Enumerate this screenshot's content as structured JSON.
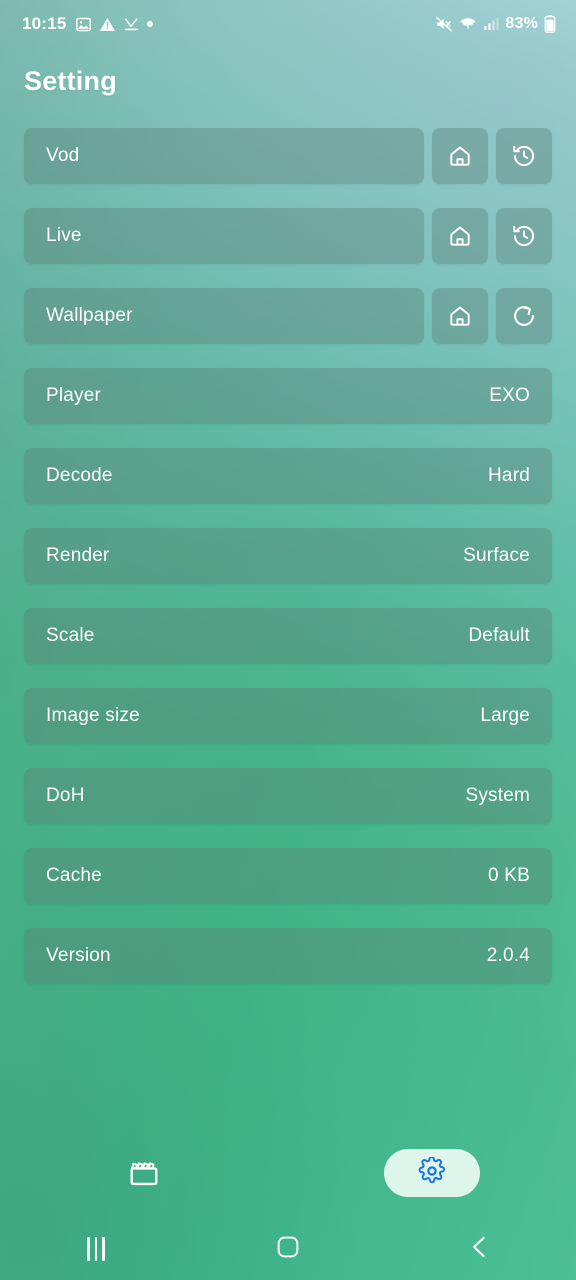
{
  "statusbar": {
    "time": "10:15",
    "left_icons": [
      "image-icon",
      "warning-triangle-icon",
      "download-complete-icon",
      "dot-icon"
    ],
    "right_icons": [
      "mute-icon",
      "wifi-icon",
      "signal-bars-icon"
    ],
    "battery_percent": "83%",
    "battery_icon": "battery-icon"
  },
  "header": {
    "title": "Setting"
  },
  "settings": {
    "rows_with_buttons": [
      {
        "label": "Vod",
        "buttons": [
          {
            "name": "home-icon",
            "action": "home"
          },
          {
            "name": "history-icon",
            "action": "history"
          }
        ]
      },
      {
        "label": "Live",
        "buttons": [
          {
            "name": "home-icon",
            "action": "home"
          },
          {
            "name": "history-icon",
            "action": "history"
          }
        ]
      },
      {
        "label": "Wallpaper",
        "buttons": [
          {
            "name": "home-icon",
            "action": "home"
          },
          {
            "name": "refresh-icon",
            "action": "refresh"
          }
        ]
      }
    ],
    "rows_with_values": [
      {
        "label": "Player",
        "value": "EXO"
      },
      {
        "label": "Decode",
        "value": "Hard"
      },
      {
        "label": "Render",
        "value": "Surface"
      },
      {
        "label": "Scale",
        "value": "Default"
      },
      {
        "label": "Image size",
        "value": "Large"
      },
      {
        "label": "DoH",
        "value": "System"
      },
      {
        "label": "Cache",
        "value": "0 KB"
      },
      {
        "label": "Version",
        "value": "2.0.4"
      }
    ]
  },
  "bottom_nav": {
    "items": [
      {
        "icon": "clapperboard-icon",
        "label": "",
        "active": false
      },
      {
        "icon": "gear-icon",
        "label": "",
        "active": true
      }
    ],
    "active_pill_color": "#e9faf3",
    "active_icon_color": "#1a73e8"
  },
  "system_nav": {
    "buttons": [
      {
        "name": "recents-icon"
      },
      {
        "name": "home-square-icon"
      },
      {
        "name": "back-chevron-icon"
      }
    ]
  },
  "colors": {
    "background_top": "#a8dcd8",
    "background_bottom": "#3cb688",
    "row_fill": "rgba(92,128,118,0.40)",
    "text": "#ffffff",
    "accent_blue": "#1a73e8"
  }
}
